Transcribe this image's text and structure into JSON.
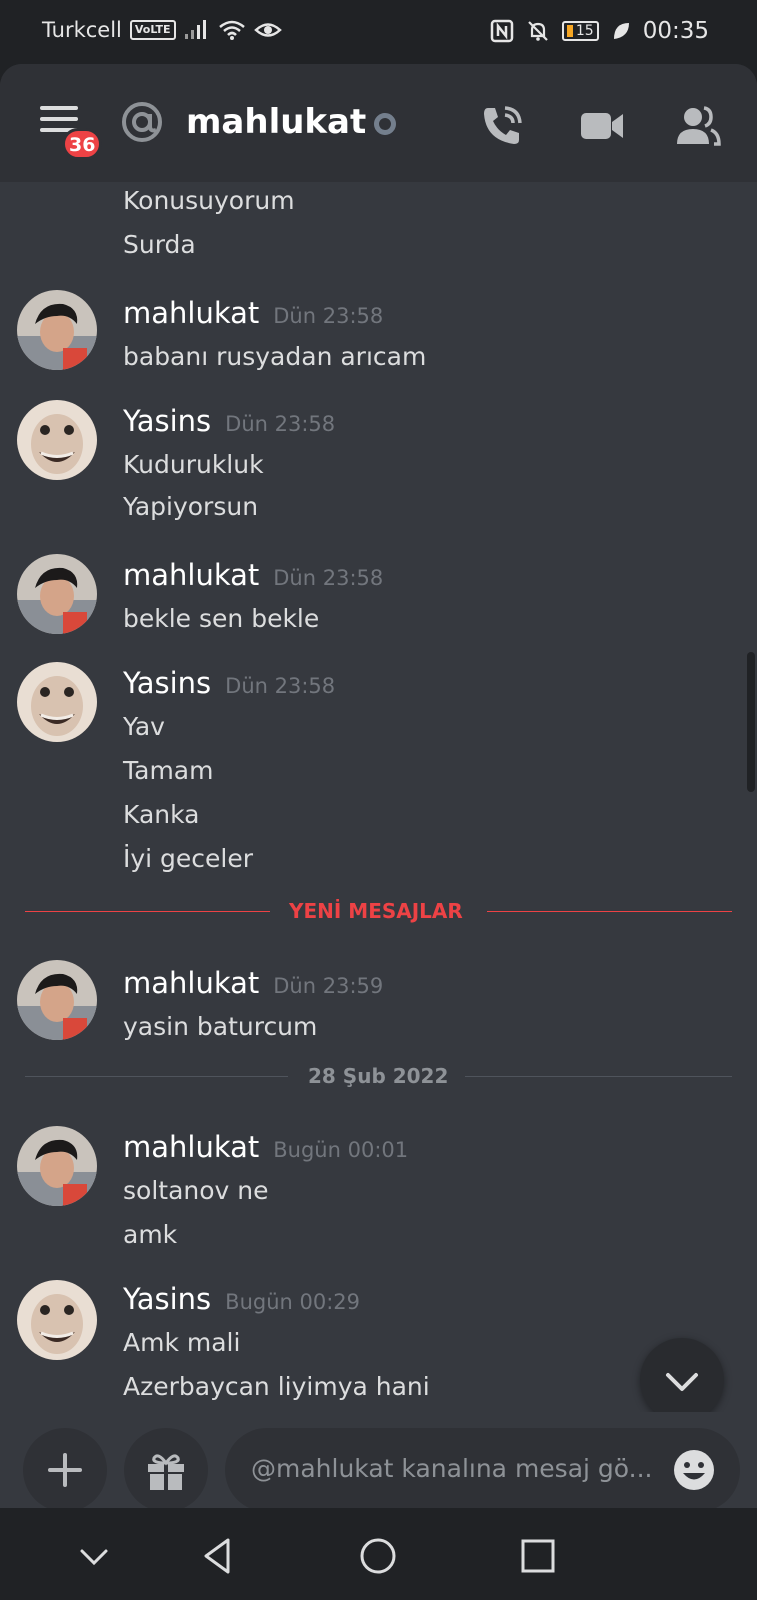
{
  "status_bar": {
    "carrier": "Turkcell",
    "volte": "VoLTE",
    "battery": "15",
    "time": "00:35"
  },
  "header": {
    "badge_count": "36",
    "channel_name": "mahlukat"
  },
  "messages": {
    "top_lines": [
      "Konusuyorum",
      "Surda"
    ],
    "g1": {
      "author": "mahlukat",
      "time": "Dün 23:58",
      "lines": [
        "babanı rusyadan arıcam"
      ]
    },
    "g2": {
      "author": "Yasins",
      "time": "Dün 23:58",
      "lines": [
        "Kudurukluk",
        "Yapiyorsun"
      ]
    },
    "g3": {
      "author": "mahlukat",
      "time": "Dün 23:58",
      "lines": [
        "bekle sen bekle"
      ]
    },
    "g4": {
      "author": "Yasins",
      "time": "Dün 23:58",
      "lines": [
        "Yav",
        "Tamam",
        "Kanka",
        "İyi geceler"
      ]
    },
    "new_messages_label": "YENİ MESAJLAR",
    "g5": {
      "author": "mahlukat",
      "time": "Dün 23:59",
      "lines": [
        "yasin baturcum"
      ]
    },
    "date_separator": "28 Şub 2022",
    "g6": {
      "author": "mahlukat",
      "time": "Bugün 00:01",
      "lines": [
        "soltanov ne",
        "amk"
      ]
    },
    "g7": {
      "author": "Yasins",
      "time": "Bugün 00:29",
      "lines": [
        "Amk mali",
        "Azerbaycan liyimya hani"
      ]
    }
  },
  "composer": {
    "placeholder": "@mahlukat kanalına mesaj gö..."
  },
  "colors": {
    "background": "#36393f",
    "header": "#2f3136",
    "accent_red": "#ed4245",
    "timestamp": "#72767d"
  }
}
